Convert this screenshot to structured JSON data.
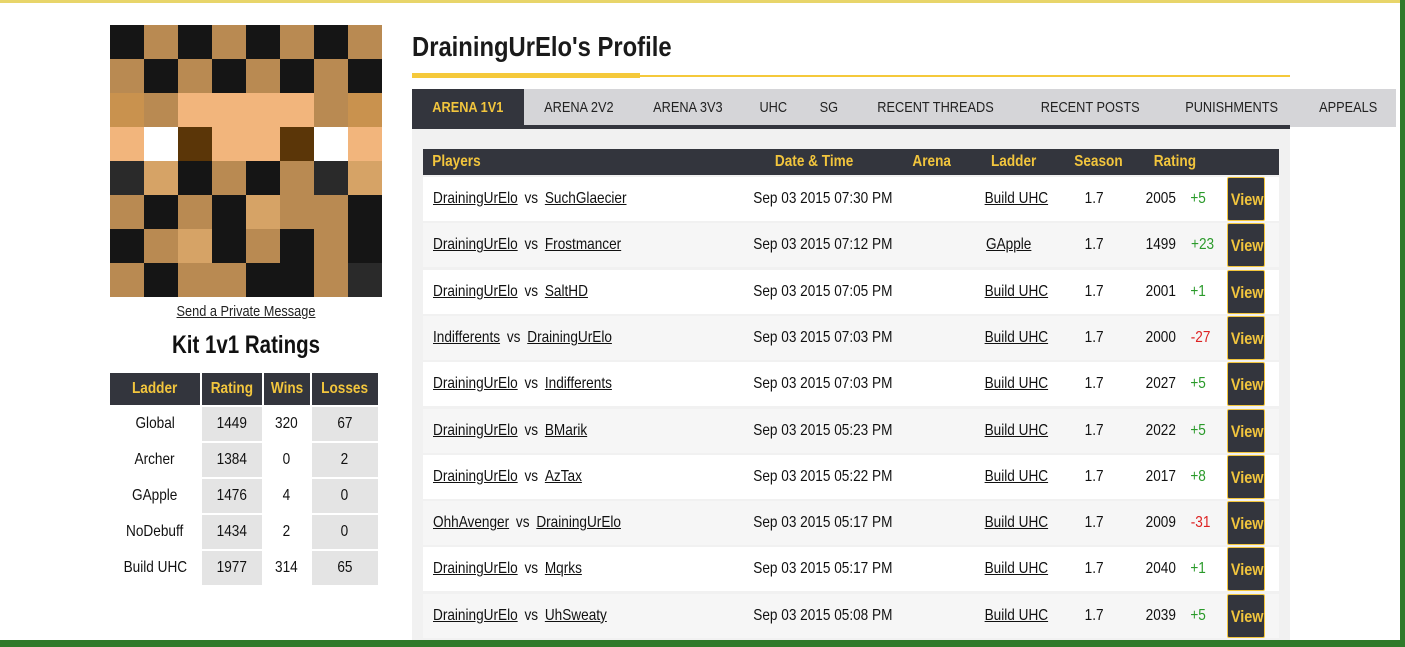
{
  "colors": {
    "dark": "#33353d",
    "gold": "#f2c53d",
    "positive": "#2a9a2a",
    "negative": "#dd2222"
  },
  "sidebar": {
    "private_message": "Send a Private Message",
    "kit_title": "Kit 1v1 Ratings",
    "table": {
      "headers": [
        "Ladder",
        "Rating",
        "Wins",
        "Losses"
      ],
      "rows": [
        [
          "Global",
          "1449",
          "320",
          "67"
        ],
        [
          "Archer",
          "1384",
          "0",
          "2"
        ],
        [
          "GApple",
          "1476",
          "4",
          "0"
        ],
        [
          "NoDebuff",
          "1434",
          "2",
          "0"
        ],
        [
          "Build UHC",
          "1977",
          "314",
          "65"
        ]
      ]
    }
  },
  "profile_title": "DrainingUrElo's Profile",
  "tabs": [
    {
      "label": "ARENA 1V1",
      "active": true
    },
    {
      "label": "ARENA 2V2"
    },
    {
      "label": "ARENA 3V3"
    },
    {
      "label": "UHC"
    },
    {
      "label": "SG"
    },
    {
      "label": "RECENT THREADS"
    },
    {
      "label": "RECENT POSTS"
    },
    {
      "label": "PUNISHMENTS"
    },
    {
      "label": "APPEALS"
    }
  ],
  "matches": {
    "headers": {
      "players": "Players",
      "datetime": "Date & Time",
      "arena": "Arena",
      "ladder": "Ladder",
      "season": "Season",
      "rating": "Rating"
    },
    "vs_label": "vs",
    "view_label": "View",
    "rows": [
      {
        "p1": "DrainingUrElo",
        "p2": "SuchGlaecier",
        "datetime": "Sep 03 2015 07:30 PM",
        "ladder": "Build UHC",
        "season": "1.7",
        "rating": "2005",
        "delta": "+5"
      },
      {
        "p1": "DrainingUrElo",
        "p2": "Frostmancer",
        "datetime": "Sep 03 2015 07:12 PM",
        "ladder": "GApple",
        "season": "1.7",
        "rating": "1499",
        "delta": "+23"
      },
      {
        "p1": "DrainingUrElo",
        "p2": "SaltHD",
        "datetime": "Sep 03 2015 07:05 PM",
        "ladder": "Build UHC",
        "season": "1.7",
        "rating": "2001",
        "delta": "+1"
      },
      {
        "p1": "Indifferents",
        "p2": "DrainingUrElo",
        "datetime": "Sep 03 2015 07:03 PM",
        "ladder": "Build UHC",
        "season": "1.7",
        "rating": "2000",
        "delta": "-27"
      },
      {
        "p1": "DrainingUrElo",
        "p2": "Indifferents",
        "datetime": "Sep 03 2015 07:03 PM",
        "ladder": "Build UHC",
        "season": "1.7",
        "rating": "2027",
        "delta": "+5"
      },
      {
        "p1": "DrainingUrElo",
        "p2": "BMarik",
        "datetime": "Sep 03 2015 05:23 PM",
        "ladder": "Build UHC",
        "season": "1.7",
        "rating": "2022",
        "delta": "+5"
      },
      {
        "p1": "DrainingUrElo",
        "p2": "AzTax",
        "datetime": "Sep 03 2015 05:22 PM",
        "ladder": "Build UHC",
        "season": "1.7",
        "rating": "2017",
        "delta": "+8"
      },
      {
        "p1": "OhhAvenger",
        "p2": "DrainingUrElo",
        "datetime": "Sep 03 2015 05:17 PM",
        "ladder": "Build UHC",
        "season": "1.7",
        "rating": "2009",
        "delta": "-31"
      },
      {
        "p1": "DrainingUrElo",
        "p2": "Mqrks",
        "datetime": "Sep 03 2015 05:17 PM",
        "ladder": "Build UHC",
        "season": "1.7",
        "rating": "2040",
        "delta": "+1"
      },
      {
        "p1": "DrainingUrElo",
        "p2": "UhSweaty",
        "datetime": "Sep 03 2015 05:08 PM",
        "ladder": "Build UHC",
        "season": "1.7",
        "rating": "2039",
        "delta": "+5"
      }
    ]
  }
}
